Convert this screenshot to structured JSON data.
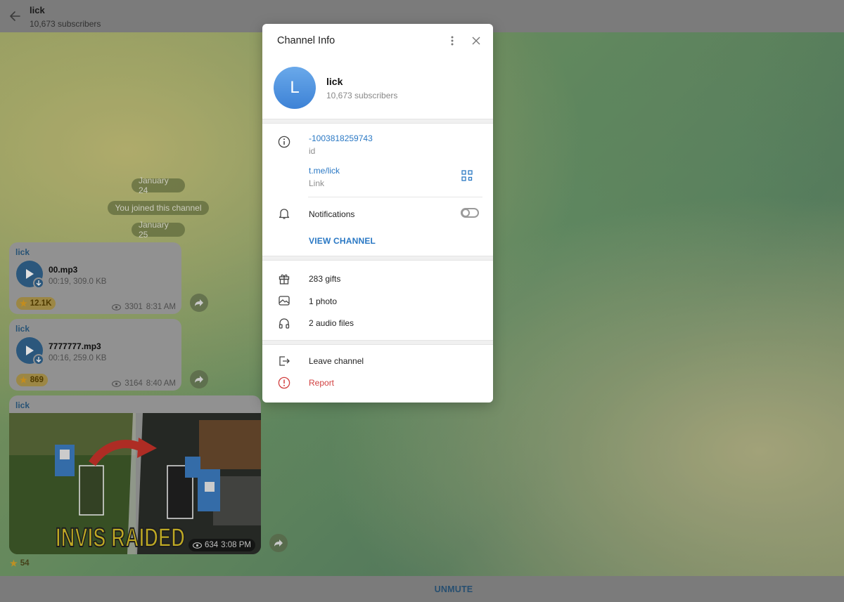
{
  "header": {
    "title": "lick",
    "subtitle": "10,673 subscribers"
  },
  "service": {
    "date1": "January 24",
    "joined": "You joined this channel",
    "date2": "January 25"
  },
  "messages": [
    {
      "sender": "lick",
      "file_name": "00.mp3",
      "file_meta": "00:19, 309.0 KB",
      "reactions": "12.1K",
      "views": "3301",
      "time": "8:31 AM"
    },
    {
      "sender": "lick",
      "file_name": "7777777.mp3",
      "file_meta": "00:16, 259.0 KB",
      "reactions": "869",
      "views": "3164",
      "time": "8:40 AM"
    },
    {
      "sender": "lick",
      "photo_caption_text": "INVIS RAIDED",
      "views": "634",
      "time": "3:08 PM",
      "reactions": "54"
    }
  ],
  "bottom": {
    "unmute_label": "UNMUTE"
  },
  "modal": {
    "title": "Channel Info",
    "avatar_letter": "L",
    "name": "lick",
    "subscribers": "10,673 subscribers",
    "id_value": "-1003818259743",
    "id_label": "id",
    "link_value": "t.me/lick",
    "link_label": "Link",
    "notifications_label": "Notifications",
    "notifications_on": false,
    "view_channel_label": "VIEW CHANNEL",
    "gifts": "283 gifts",
    "photos": "1 photo",
    "audio": "2 audio files",
    "leave": "Leave channel",
    "report": "Report"
  },
  "colors": {
    "accent": "#2a78c4",
    "danger": "#d13f3f",
    "avatar": "#4a8ee0"
  }
}
